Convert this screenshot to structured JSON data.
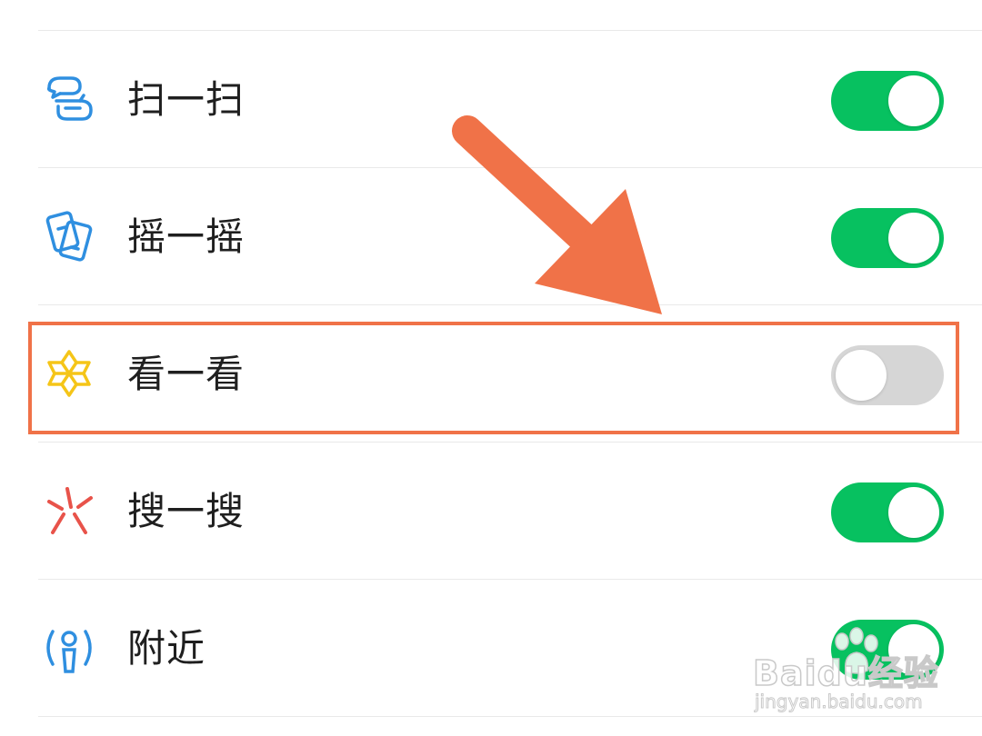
{
  "settings": {
    "items": [
      {
        "id": "scan",
        "label": "扫一扫",
        "icon": "scan-icon",
        "enabled": true
      },
      {
        "id": "shake",
        "label": "摇一摇",
        "icon": "shake-icon",
        "enabled": true
      },
      {
        "id": "look",
        "label": "看一看",
        "icon": "look-icon",
        "enabled": false
      },
      {
        "id": "search",
        "label": "搜一搜",
        "icon": "search-icon",
        "enabled": true
      },
      {
        "id": "nearby",
        "label": "附近",
        "icon": "nearby-icon",
        "enabled": true
      }
    ]
  },
  "annotation": {
    "color": "#f07248",
    "highlighted_item": "看一看"
  },
  "colors": {
    "toggle_on": "#07c160",
    "toggle_off": "#d6d6d6",
    "scan_icon": "#2f8fe0",
    "look_icon": "#f5c518",
    "search_icon": "#e8534a"
  },
  "watermark": {
    "brand": "Baidu经验",
    "url": "jingyan.baidu.com"
  }
}
